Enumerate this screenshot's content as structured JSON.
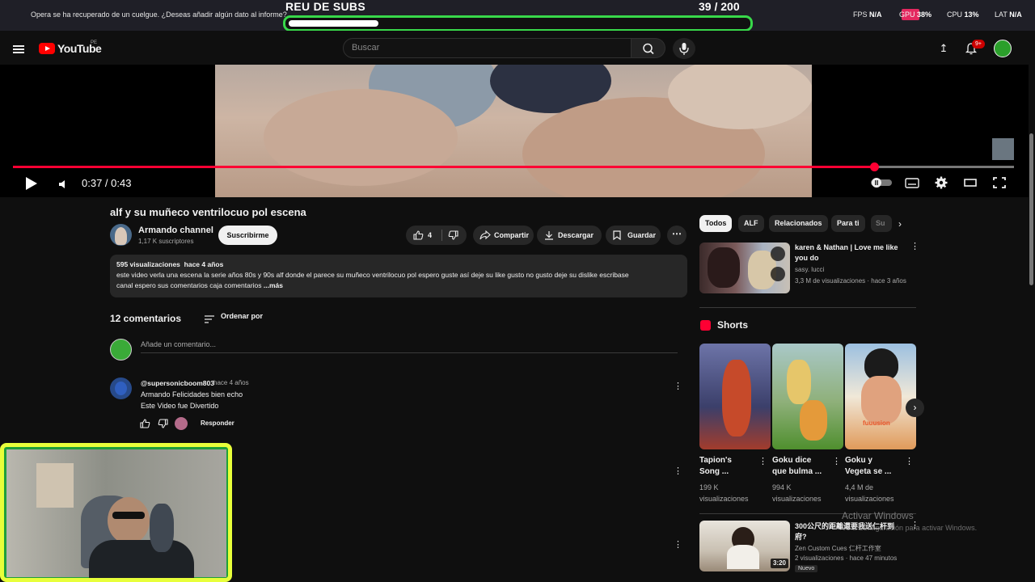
{
  "opera": {
    "message": "Opera se ha recuperado de un cuelgue. ¿Deseas añadir algún dato al informe?"
  },
  "overlay": {
    "subs_title": "REU DE SUBS",
    "subs_count": "39  / 200",
    "subs_progress": 0.195,
    "hud_fps_label": "FPS",
    "hud_fps": "N/A",
    "hud_gpu_label": "GPU",
    "hud_gpu": "38%",
    "hud_cpu_label": "CPU",
    "hud_cpu": "13%",
    "hud_lat_label": "LAT",
    "hud_lat": "N/A"
  },
  "header": {
    "logo_text": "YouTube",
    "region": "PE",
    "search_placeholder": "Buscar",
    "notif_count": "9+"
  },
  "player": {
    "current_time": "0:37",
    "duration": "0:43",
    "time_display": "0:37 / 0:43",
    "progress": 0.86
  },
  "video": {
    "title": "alf y su muñeco ventrilocuo pol escena",
    "channel": "Armando channel",
    "subscribers": "1,17 K suscriptores",
    "subscribe_label": "Suscribirme",
    "likes": "4",
    "share_label": "Compartir",
    "download_label": "Descargar",
    "save_label": "Guardar",
    "views": "595 visualizaciones",
    "age": "hace 4 años",
    "description_line1": "este video verla una escena la serie años 80s y 90s alf donde  el parece su muñeco ventrilocuo pol espero guste así deje su like gusto no gusto deje su dislike escribase",
    "description_line2": "canal espero sus comentarios caja comentarios ",
    "more_label": "...más"
  },
  "comments": {
    "count_label": "12 comentarios",
    "sort_label": "Ordenar por",
    "add_placeholder": "Añade un comentario...",
    "items": [
      {
        "user": "@supersonicboom803",
        "time": "hace 4 años",
        "line1": "Armando Felicidades bien echo",
        "line2": "Este Video fue Divertido",
        "reply_label": "Responder"
      }
    ]
  },
  "sidebar": {
    "chips": [
      "Todos",
      "ALF",
      "Relacionados",
      "Para ti",
      "Su"
    ],
    "rec1": {
      "title_line1": "karen & Nathan | Love me like",
      "title_line2": "you do",
      "channel": "sasy. lucci",
      "meta": "3,3 M de visualizaciones · hace 3 años"
    },
    "shorts_heading": "Shorts",
    "shorts": [
      {
        "title1": "Tapion's",
        "title2": "Song ...",
        "views1": "199 K",
        "views2": "visualizaciones"
      },
      {
        "title1": "Goku dice",
        "title2": "que bulma ...",
        "views1": "994 K",
        "views2": "visualizaciones"
      },
      {
        "title1": "Goku y",
        "title2": "Vegeta se ...",
        "views1": "4,4 M de",
        "views2": "visualizaciones"
      }
    ],
    "short3_caption": "fuuusion",
    "rec2": {
      "title_line1": "300公尺的距離還要我送仁杆到",
      "title_line2": "府?",
      "channel": "Zen Custom Cues 仁杆工作室",
      "meta": "2 visualizaciones · hace 47 minutos",
      "duration": "3:20",
      "badge": "Nuevo"
    }
  },
  "windows": {
    "activate_title": "Activar Windows",
    "activate_sub": "Ve a Configuración para activar Windows."
  },
  "colors": {
    "accent": "#ff0033",
    "subs_bar": "#38d84a",
    "cam_border": "#e8ff3a"
  }
}
